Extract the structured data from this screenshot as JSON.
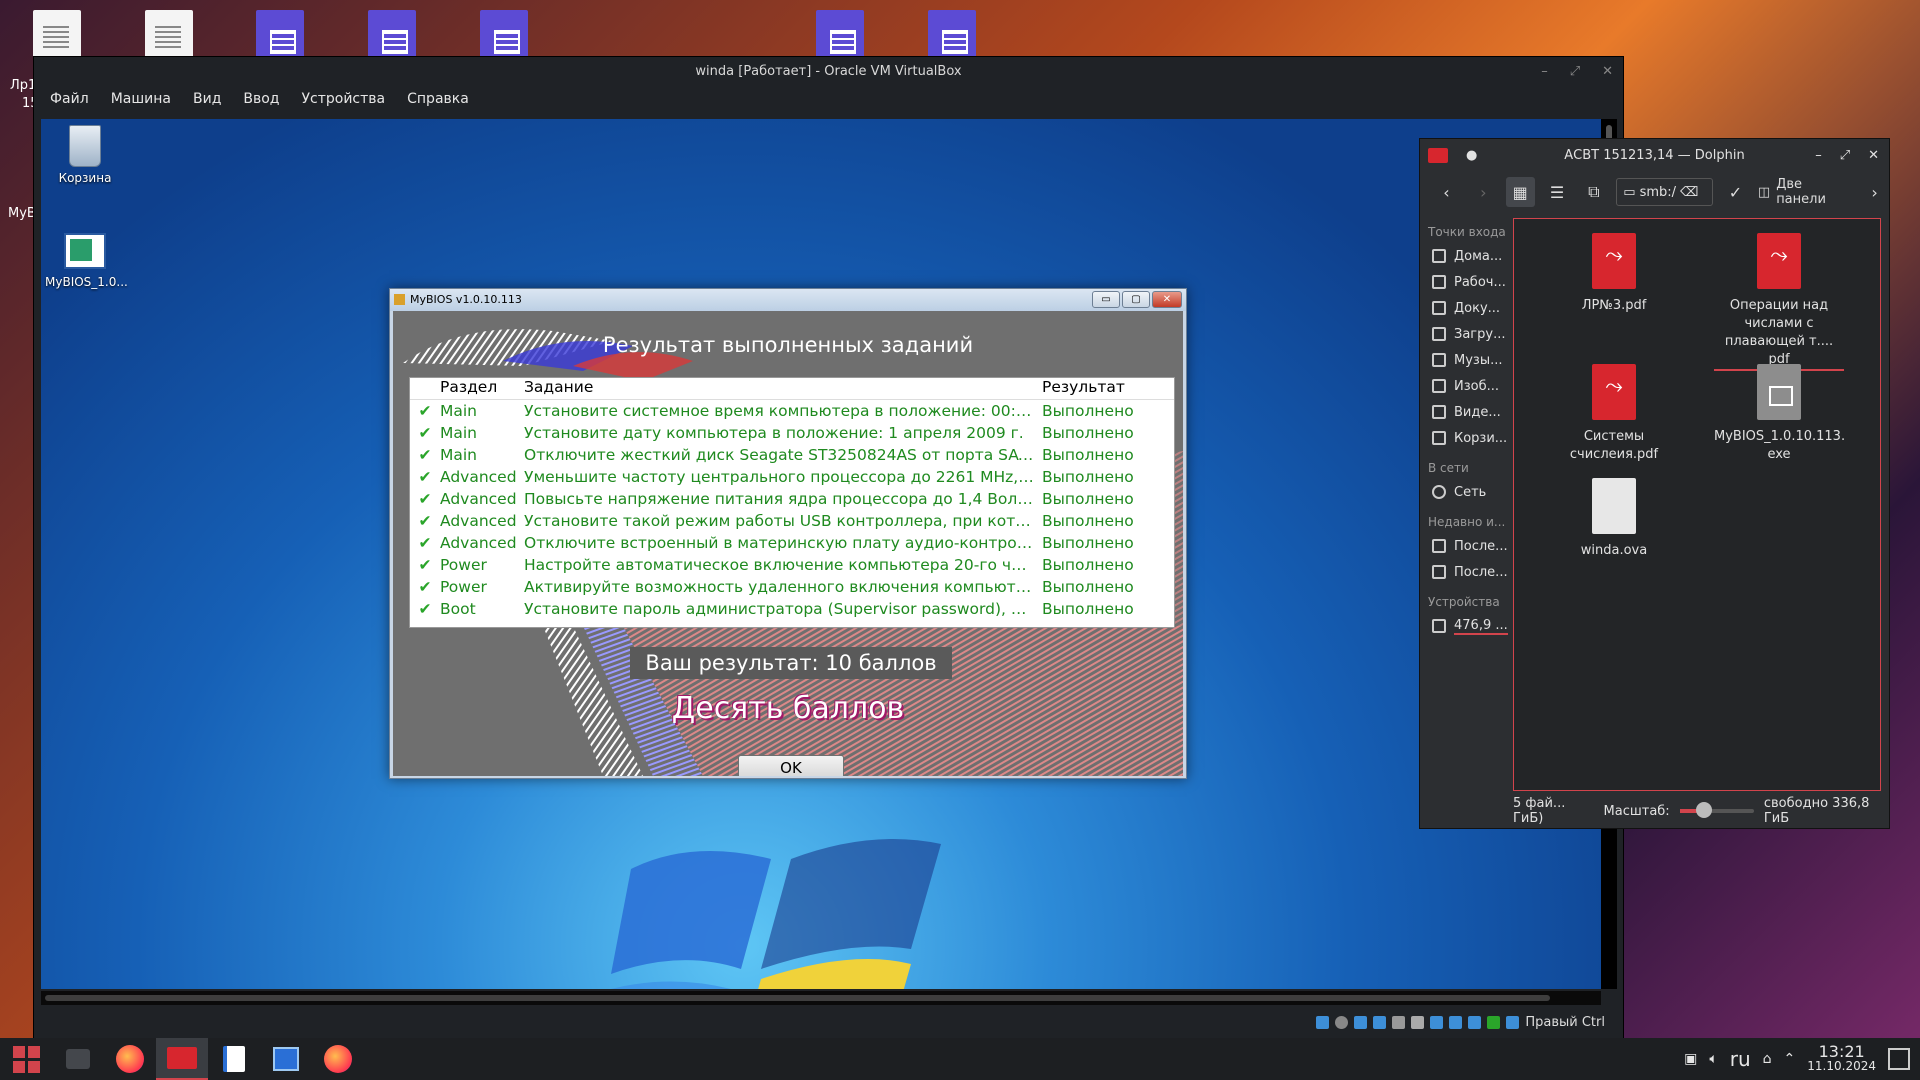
{
  "host_desktop": {
    "left_labels": [
      "Лр1",
      "15",
      "MyB"
    ]
  },
  "virtualbox": {
    "title": "winda [Работает] - Oracle VM VirtualBox",
    "window_controls": [
      "–",
      "⤢",
      "✕"
    ],
    "menu": [
      "Файл",
      "Машина",
      "Вид",
      "Ввод",
      "Устройства",
      "Справка"
    ],
    "status_key": "Правый Ctrl",
    "guest": {
      "icons": [
        {
          "label": "Корзина",
          "icon": "recycle-bin-icon"
        },
        {
          "label": "MyBIOS_1.0...",
          "icon": "app-icon"
        }
      ]
    }
  },
  "mybios": {
    "title": "MyBIOS v1.0.10.113",
    "window_controls": [
      "▭",
      "▢",
      "✕"
    ],
    "heading": "Результат выполненных заданий",
    "columns": [
      "Раздел",
      "Задание",
      "Результат"
    ],
    "rows": [
      {
        "section": "Main",
        "task": "Установите системное время компьютера в положение: 00:00...",
        "result": "Выполнено"
      },
      {
        "section": "Main",
        "task": "Установите дату компьютера в положение: 1 апреля 2009 г.",
        "result": "Выполнено"
      },
      {
        "section": "Main",
        "task": "Отключите жесткий диск Seagate ST3250824AS от порта SATA...",
        "result": "Выполнено"
      },
      {
        "section": "Advanced",
        "task": "Уменьшите частоту центрального процессора до 2261 MHz, п...",
        "result": "Выполнено"
      },
      {
        "section": "Advanced",
        "task": "Повысьте напряжение питания ядра процессора до 1,4 Вольта.",
        "result": "Выполнено"
      },
      {
        "section": "Advanced",
        "task": "Установите такой режим работы USB контроллера, при котор...",
        "result": "Выполнено"
      },
      {
        "section": "Advanced",
        "task": "Отключите встроенный в материнскую плату аудио-контроллер.",
        "result": "Выполнено"
      },
      {
        "section": "Power",
        "task": "Настройте автоматическое включение компьютера 20-го числ...",
        "result": "Выполнено"
      },
      {
        "section": "Power",
        "task": "Активируйте возможность удаленного включения компьютера...",
        "result": "Выполнено"
      },
      {
        "section": "Boot",
        "task": "Установите пароль администратора (Supervisor password), соо...",
        "result": "Выполнено"
      }
    ],
    "check_mark": "✔",
    "score": "Ваш результат: 10 баллов",
    "verdict": "Десять баллов",
    "ok_label": "OK"
  },
  "dolphin": {
    "title": "АСВТ 151213,14 — Dolphin",
    "window_controls": [
      "–",
      "⤢",
      "✕"
    ],
    "address": "smb:/",
    "split_label": "Две панели",
    "sidebar": {
      "places_header": "Точки входа",
      "places": [
        "Дома...",
        "Рабоч...",
        "Доку...",
        "Загру...",
        "Музы...",
        "Изоб...",
        "Виде...",
        "Корзи..."
      ],
      "network_header": "В сети",
      "network": [
        "Сеть"
      ],
      "recent_header": "Недавно и...",
      "recent": [
        "После...",
        "После..."
      ],
      "devices_header": "Устройства",
      "devices": [
        "476,9 ..."
      ]
    },
    "files": [
      {
        "name": "ЛР№3.pdf",
        "type": "pdf"
      },
      {
        "name": "Операции над числами с плавающей т.... pdf",
        "type": "pdf"
      },
      {
        "name": "Системы счислеия.pdf",
        "type": "pdf"
      },
      {
        "name": "MyBIOS_1.0.10.113. exe",
        "type": "exe"
      },
      {
        "name": "winda.ova",
        "type": "ova"
      }
    ],
    "status_files": "5 фай... ГиБ)",
    "zoom_label": "Масштаб:",
    "free_space": "свободно 336,8 ГиБ"
  },
  "taskbar": {
    "keyboard_layout": "ru",
    "time": "13:21",
    "date": "11.10.2024"
  },
  "colors": {
    "accent": "#d2444c",
    "done": "#1f8a1f"
  }
}
